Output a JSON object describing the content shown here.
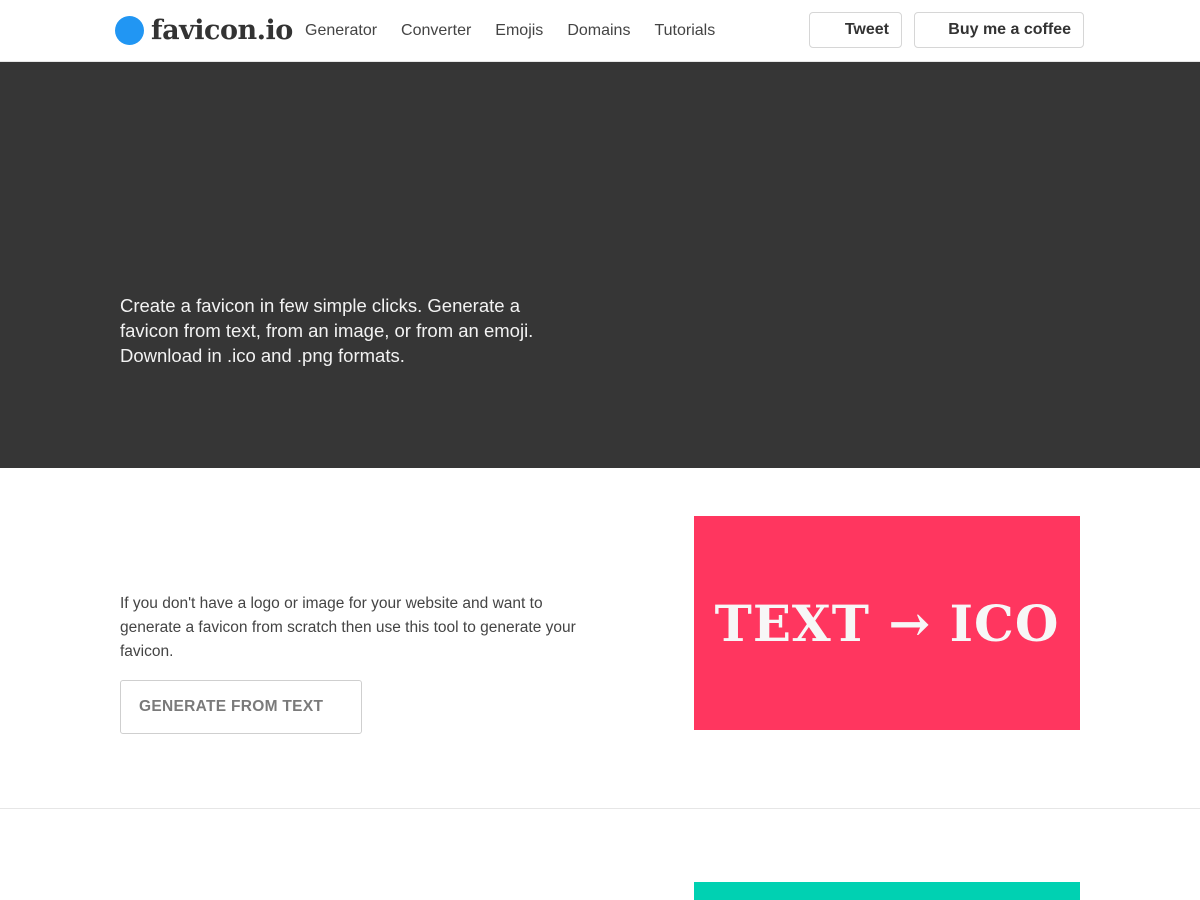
{
  "header": {
    "logo_text": "favicon.io",
    "nav": [
      {
        "label": "Generator"
      },
      {
        "label": "Converter"
      },
      {
        "label": "Emojis"
      },
      {
        "label": "Domains"
      },
      {
        "label": "Tutorials"
      }
    ],
    "tweet_label": "Tweet",
    "coffee_label": "Buy me a coffee"
  },
  "hero": {
    "description": "Create a favicon in few simple clicks. Generate a favicon from text, from an image, or from an emoji. Download in .ico and .png formats."
  },
  "text_section": {
    "description": "If you don't have a logo or image for your website and want to generate a favicon from scratch then use this tool to generate your favicon.",
    "button_label": "GENERATE FROM TEXT",
    "banner_label": "TEXT → ICO"
  },
  "colors": {
    "logo_blue": "#2196f3",
    "hero_bg": "#363636",
    "text_banner": "#ff365f",
    "next_banner": "#00d1b2"
  }
}
